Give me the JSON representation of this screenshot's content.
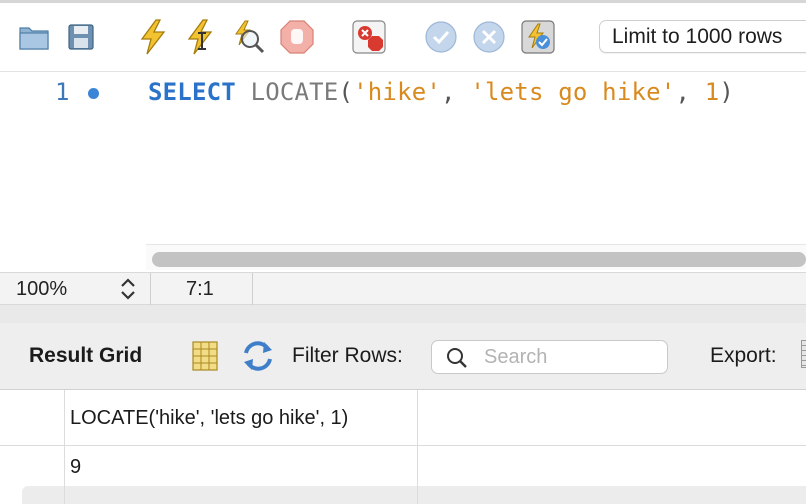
{
  "toolbar": {
    "buttons": [
      {
        "name": "open-file",
        "icon": "folder-icon"
      },
      {
        "name": "save-file",
        "icon": "floppy-icon"
      },
      {
        "name": "execute-all",
        "icon": "lightning-icon"
      },
      {
        "name": "execute-current",
        "icon": "lightning-cursor-icon"
      },
      {
        "name": "explain",
        "icon": "magnifier-icon"
      },
      {
        "name": "stop",
        "icon": "stop-hand-icon"
      },
      {
        "name": "toggle-error-stop",
        "icon": "error-stop-icon"
      },
      {
        "name": "commit",
        "icon": "check-icon"
      },
      {
        "name": "rollback",
        "icon": "x-icon"
      },
      {
        "name": "autocommit",
        "icon": "autocommit-icon"
      }
    ],
    "limit_label": "Limit to 1000 rows"
  },
  "editor": {
    "line_number": "1",
    "query": {
      "keyword": "SELECT",
      "function": "LOCATE",
      "open_paren": "(",
      "arg1": "'hike'",
      "comma1": ", ",
      "arg2": "'lets go hike'",
      "comma2": ", ",
      "arg3": "1",
      "close_paren": ")"
    }
  },
  "status": {
    "zoom": "100%",
    "cursor_position": "7:1"
  },
  "result_toolbar": {
    "title": "Result Grid",
    "filter_label": "Filter Rows:",
    "search_placeholder": "Search",
    "search_value": "",
    "export_label": "Export:"
  },
  "result_grid": {
    "columns": [
      "LOCATE('hike', 'lets go hike', 1)"
    ],
    "rows": [
      [
        "9"
      ]
    ]
  },
  "colors": {
    "keyword": "#2b73c8",
    "string_literal": "#d98a1e",
    "line_number": "#3d78b7"
  }
}
